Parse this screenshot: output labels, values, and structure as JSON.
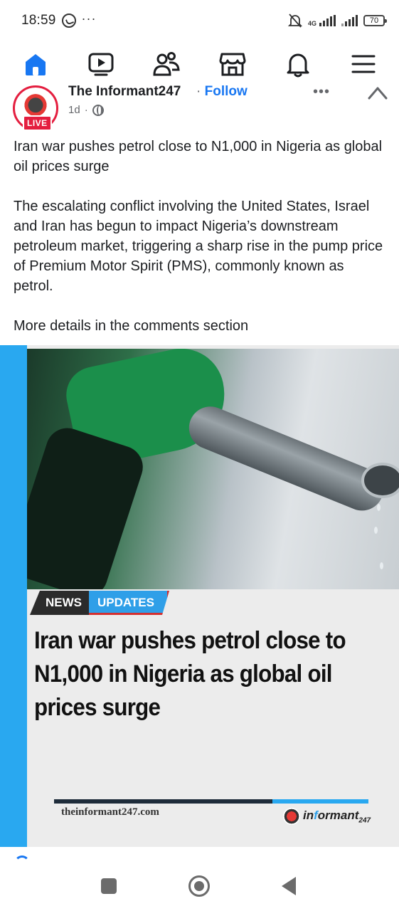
{
  "status_bar": {
    "time": "18:59",
    "more": "···",
    "network": "4G",
    "battery": "70"
  },
  "tabs": [
    {
      "name": "home",
      "icon": "home-icon",
      "active": true
    },
    {
      "name": "video",
      "icon": "video-icon"
    },
    {
      "name": "friends",
      "icon": "friends-icon"
    },
    {
      "name": "marketplace",
      "icon": "marketplace-icon"
    },
    {
      "name": "notifications",
      "icon": "bell-icon"
    },
    {
      "name": "menu",
      "icon": "menu-icon"
    }
  ],
  "post": {
    "page_name": "The Informant247",
    "separator": " · ",
    "follow_label": "Follow",
    "time": "1d",
    "time_sep": "·",
    "live_label": "LIVE",
    "more_label": "•••",
    "paragraphs": [
      "Iran war pushes petrol close to N1,000 in Nigeria as global oil prices surge",
      "The escalating conflict involving the United States, Israel and Iran has begun to impact Nigeria’s downstream petroleum market, triggering a sharp rise in the pump price of Premium Motor Spirit (PMS), commonly known as petrol.",
      "More details in the comments section"
    ]
  },
  "image": {
    "badge_news": "NEWS",
    "badge_updates": "UPDATES",
    "headline": "Iran war pushes petrol close to N1,000 in Nigeria as global oil prices surge",
    "site_url": "theinformant247.com",
    "logo_pre": "in",
    "logo_accent": "f",
    "logo_post": "ormant",
    "logo_num": "247"
  },
  "colors": {
    "brand_blue": "#1877f2",
    "live_red": "#e41e3f",
    "image_accent": "#29a8f0"
  }
}
